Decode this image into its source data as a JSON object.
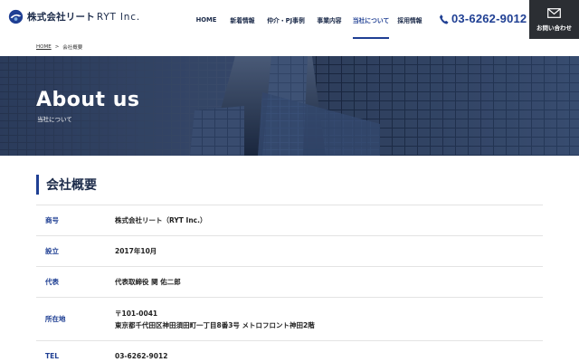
{
  "header": {
    "logo_name": "株式会社リート",
    "logo_en": "RYT Inc.",
    "nav": [
      {
        "label": "HOME",
        "active": false
      },
      {
        "label": "新着情報",
        "active": false
      },
      {
        "label": "仲介・PJ事例",
        "active": false
      },
      {
        "label": "事業内容",
        "active": false
      },
      {
        "label": "当社について",
        "active": true
      },
      {
        "label": "採用情報",
        "active": false
      }
    ],
    "phone": "03-6262-9012",
    "contact_label": "お問い合わせ"
  },
  "breadcrumb": {
    "home": "HOME",
    "separator": ">",
    "current": "会社概要"
  },
  "hero": {
    "title": "About us",
    "subtitle": "当社について"
  },
  "section": {
    "title": "会社概要"
  },
  "company_table": [
    {
      "label": "商号",
      "lines": [
        "株式会社リート（RYT Inc.）"
      ]
    },
    {
      "label": "設立",
      "lines": [
        "2017年10月"
      ]
    },
    {
      "label": "代表",
      "lines": [
        "代表取締役 関 佑二郎"
      ]
    },
    {
      "label": "所在地",
      "lines": [
        "〒101-0041",
        "東京都千代田区神田須田町一丁目8番3号 メトロフロント神田2階"
      ]
    },
    {
      "label": "TEL",
      "lines": [
        "03-6262-9012"
      ]
    }
  ],
  "colors": {
    "brand_navy": "#1f3f93",
    "text_dark": "#1c2b4a",
    "contact_bg": "#2b2e33"
  },
  "icons": [
    "logo-mark-icon",
    "phone-icon",
    "mail-icon"
  ]
}
